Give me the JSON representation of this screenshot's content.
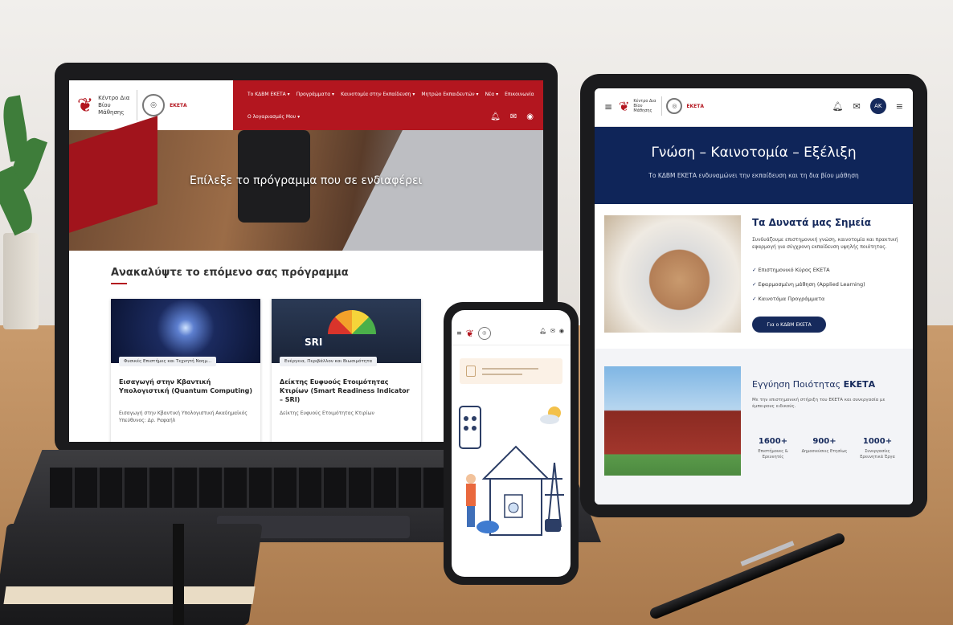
{
  "laptop": {
    "logo_text": "Κέντρο Δια Βίου Μάθησης",
    "logo_eketa": "ΕΚΕΤΑ",
    "nav": [
      "Το ΚΔΒΜ ΕΚΕΤΑ ▾",
      "Προγράμματα ▾",
      "Καινοτομία στην Εκπαίδευση ▾",
      "Μητρώο Εκπαιδευτών ▾",
      "Νέα ▾",
      "Επικοινωνία"
    ],
    "nav_second": "Ο λογαριασμός Μου ▾",
    "hero_title": "Επίλεξε το πρόγραμμα που σε ενδιαφέρει",
    "section_title": "Ανακαλύψτε το επόμενο σας πρόγραμμα",
    "cards": [
      {
        "tag": "Φυσικές Επιστήμες και Τεχνητή Νοημ...",
        "title": "Εισαγωγή στην Κβαντική Υπολογιστική (Quantum Computing)",
        "text": "Εισαγωγή στην Κβαντική Υπολογιστική Ακαδημαϊκός Υπεύθυνος: Δρ. Ραφαήλ"
      },
      {
        "tag": "Ενέργεια, Περιβάλλον και Βιωσιμότητα",
        "title": "Δείκτης Ευφυούς Ετοιμότητας Κτιρίων (Smart Readiness Indicator – SRI)",
        "text": "Δείκτης Ευφυούς Ετοιμότητας Κτιρίων"
      }
    ],
    "card_badge": "SRI"
  },
  "tablet": {
    "hero_title": "Γνώση – Καινοτομία – Εξέλιξη",
    "hero_sub": "Το ΚΔΒΜ ΕΚΕΤΑ ενδυναμώνει την εκπαίδευση και τη δια βίου μάθηση",
    "avatar": "AK",
    "s1_title": "Τα Δυνατά μας Σημεία",
    "s1_text": "Συνδυάζουμε επιστημονική γνώση, καινοτομία και πρακτική εφαρμογή για σύγχρονη εκπαίδευση υψηλής ποιότητας.",
    "checks": [
      "Επιστημονικό Κύρος ΕΚΕΤΑ",
      "Εφαρμοσμένη μάθηση (Applied Learning)",
      "Καινοτόμα Προγράμματα"
    ],
    "s1_button": "Για ο ΚΔΒΜ ΕΚΕΤΑ",
    "s2_title": "Εγγύηση Ποιότητας",
    "s2_title_bold": "ΕΚΕΤΑ",
    "s2_text": "Με την επιστημονική στήριξη του ΕΚΕΤΑ και συνεργασία με έμπειρους ειδικούς.",
    "stats": [
      {
        "value": "1600+",
        "label": "Επιστήμονες & Ερευνητές"
      },
      {
        "value": "900+",
        "label": "Δημοσιεύσεις Ετησίως"
      },
      {
        "value": "1000+",
        "label": "Συνεργασίες Ερευνητικά Έργα"
      }
    ]
  },
  "icons": [
    "menu-icon",
    "bell-icon",
    "mail-icon",
    "user-icon",
    "check-icon"
  ],
  "colors": {
    "brand_red": "#b3161f",
    "brand_navy": "#0f2559"
  }
}
